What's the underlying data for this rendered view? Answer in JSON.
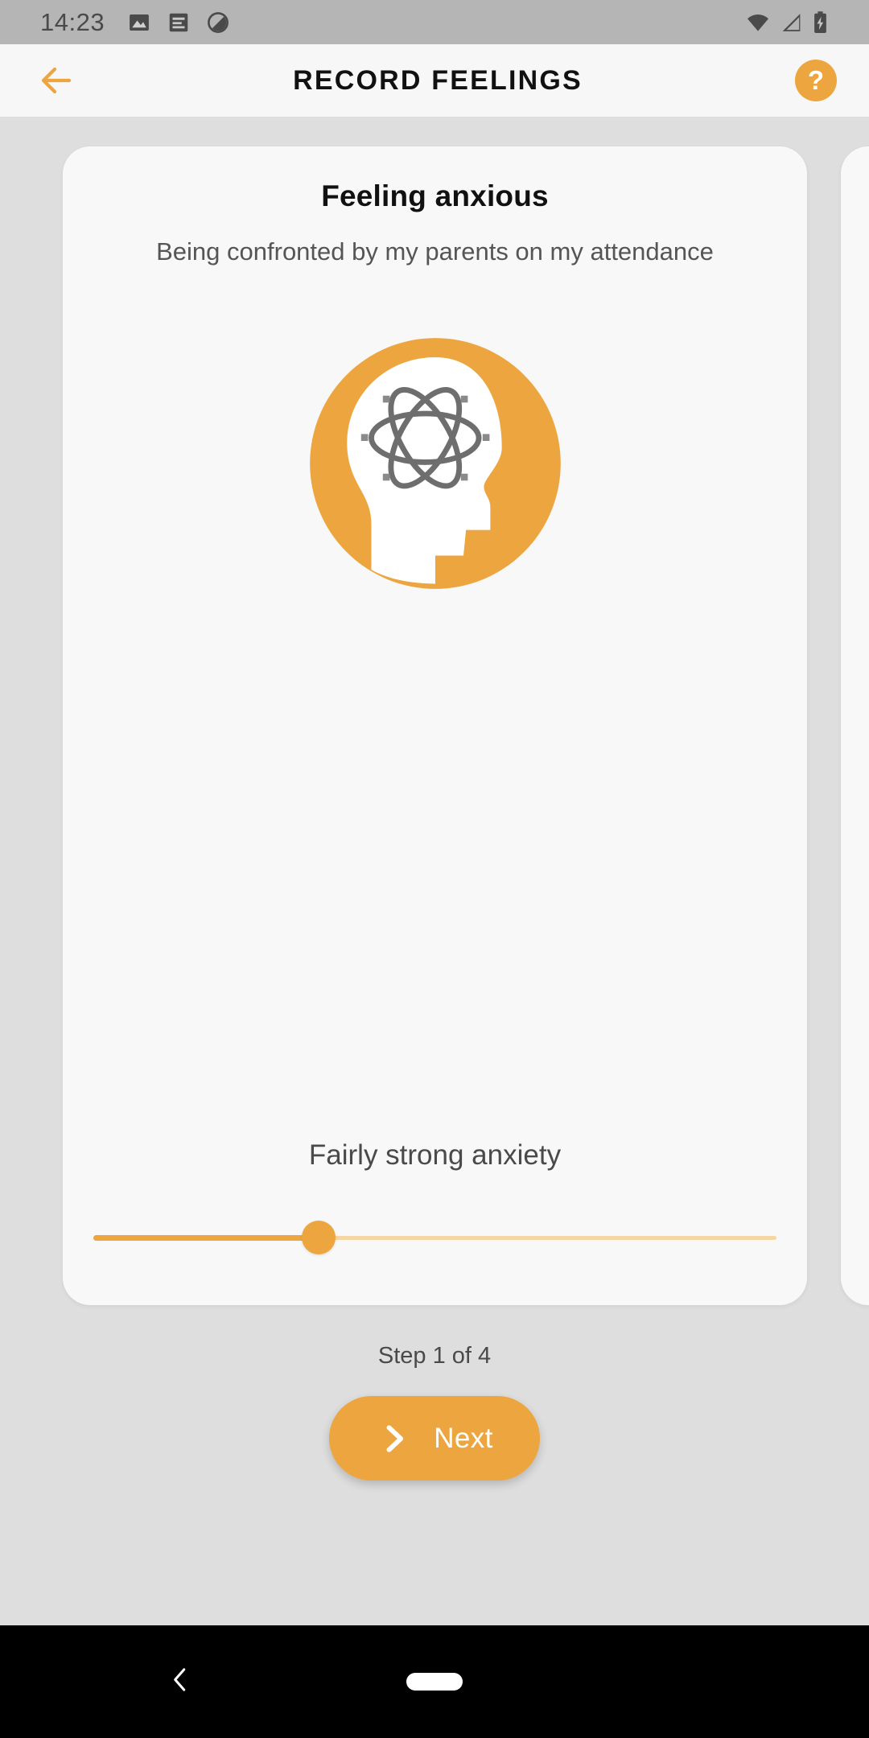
{
  "statusbar": {
    "time": "14:23",
    "left_icons": [
      "image-icon",
      "article-icon",
      "do-not-disturb-icon"
    ],
    "right_icons": [
      "wifi-icon",
      "cellular-signal-icon",
      "battery-charging-icon"
    ],
    "background_color": "#b5b5b5"
  },
  "header": {
    "title": "RECORD FEELINGS",
    "back_icon": "arrow-left-icon",
    "help_label": "?",
    "accent_color": "#eda63f",
    "background_color": "#f7f7f7"
  },
  "card": {
    "title": "Feeling anxious",
    "subtitle": "Being confronted by my parents on my attendance",
    "illustration": "head-with-atom-icon",
    "illustration_colors": {
      "circle": "#eda63f",
      "head": "#ffffff",
      "atom": "#6e6e6e"
    }
  },
  "slider": {
    "label": "Fairly strong anxiety",
    "value_percent": 33,
    "fill_color": "#eda63f",
    "track_color": "#f4d7a4"
  },
  "footer": {
    "step_text": "Step 1 of 4",
    "next_label": "Next",
    "next_icon": "chevron-right-icon",
    "button_color": "#eda63f"
  },
  "navbar": {
    "back_icon": "nav-back-chevron-icon",
    "home_icon": "nav-home-pill-icon",
    "background_color": "#000000"
  }
}
